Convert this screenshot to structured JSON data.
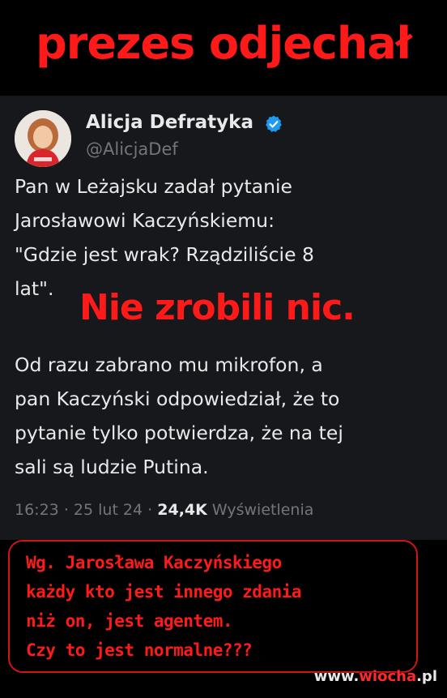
{
  "headline": "prezes odjechał",
  "tweet": {
    "author_name": "Alicja Defratyka",
    "author_handle": "@AlicjaDef",
    "verified_icon": "verified-badge-icon",
    "body_lines": [
      "Pan w Leżajsku zadał pytanie",
      "Jarosławowi Kaczyńskiemu:",
      "\"Gdzie jest wrak? Rządziliście 8",
      "lat\".",
      "Od razu zabrano mu mikrofon, a",
      "pan Kaczyński odpowiedział, że to",
      "pytanie tylko potwierdza, że na tej",
      "sali są ludzie Putina."
    ],
    "time": "16:23",
    "date": "25 lut 24",
    "views_count": "24,4K",
    "views_label": "Wyświetlenia"
  },
  "overlay_text": "Nie zrobili nic.",
  "caption_lines": [
    "Wg. Jarosława Kaczyńskiego",
    "każdy kto jest innego zdania",
    "niż on, jest agentem.",
    "Czy to jest normalne???"
  ],
  "watermark": {
    "prefix": "www.",
    "accent": "wiocha",
    "suffix": ".pl"
  },
  "colors": {
    "accent_red": "#ff1a1a",
    "tweet_bg": "#16181c",
    "verified_blue": "#1d9bf0"
  }
}
